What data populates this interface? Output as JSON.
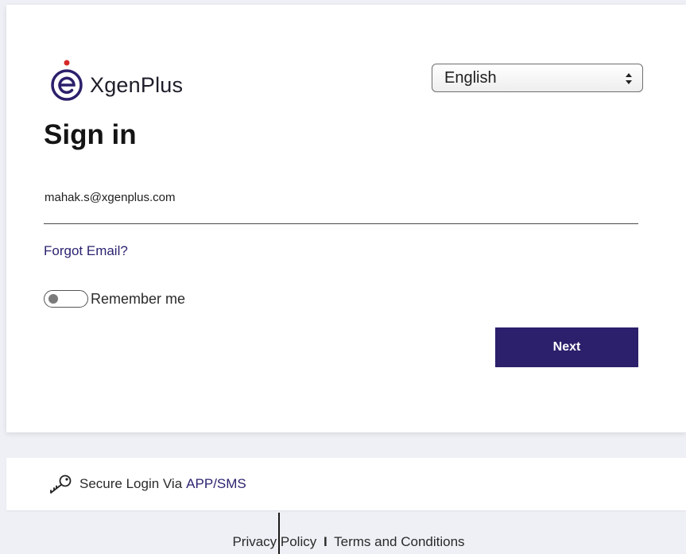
{
  "brand": {
    "name": "XgenPlus",
    "logo_icon": "xgenplus-e-logo-icon",
    "logo_color": "#2c1f6b",
    "dot_color": "#d62828"
  },
  "language_select": {
    "selected": "English",
    "icon": "chevron-up-down-icon"
  },
  "signin": {
    "title": "Sign in",
    "email_value": "mahak.s@xgenplus.com",
    "forgot_label": "Forgot Email?",
    "remember_label": "Remember me",
    "remember_on": false,
    "next_label": "Next",
    "accent_color": "#2c1f6b"
  },
  "secure_login": {
    "icon": "key-icon",
    "prefix": "Secure Login Via",
    "link": "APP/SMS"
  },
  "footer": {
    "privacy": "Privacy Policy",
    "separator": "I",
    "terms": "Terms and Conditions"
  }
}
